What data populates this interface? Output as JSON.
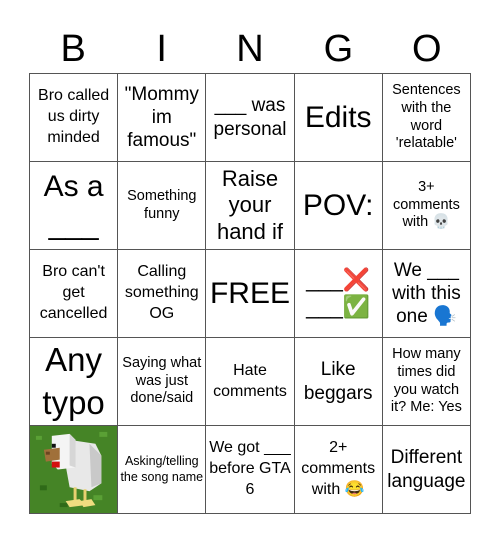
{
  "header": {
    "letters": [
      "B",
      "I",
      "N",
      "G",
      "O"
    ]
  },
  "board": {
    "rows": [
      [
        {
          "text": "Bro called us dirty minded"
        },
        {
          "text": "\"Mommy im famous\""
        },
        {
          "text": "___ was personal"
        },
        {
          "text": "Edits"
        },
        {
          "text": "Sentences with the word 'relatable'"
        }
      ],
      [
        {
          "text": "As a ___"
        },
        {
          "text": "Something funny"
        },
        {
          "text": "Raise your hand if"
        },
        {
          "text": "POV:"
        },
        {
          "text": "3+ comments with 💀"
        }
      ],
      [
        {
          "text": "Bro can't get cancelled"
        },
        {
          "text": "Calling something OG"
        },
        {
          "text": "FREE"
        },
        {
          "text": "___❌ ___✅"
        },
        {
          "text": "We ___ with this one 🗣️"
        }
      ],
      [
        {
          "text": "Any typo"
        },
        {
          "text": "Saying what was just done/said"
        },
        {
          "text": "Hate comments"
        },
        {
          "text": "Like beggars"
        },
        {
          "text": "How many times did you watch it? Me: Yes"
        }
      ],
      [
        {
          "text": "",
          "image": "minecraft-chicken"
        },
        {
          "text": "Asking/telling the song name"
        },
        {
          "text": "We got ___ before GTA 6"
        },
        {
          "text": "2+ comments with 😂"
        },
        {
          "text": "Different language"
        }
      ]
    ],
    "free_space_label": "FREE"
  }
}
